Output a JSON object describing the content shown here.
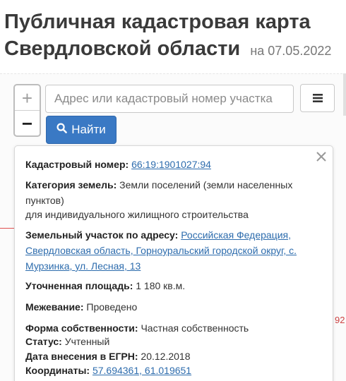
{
  "header": {
    "title": "Публичная кадастровая карта Свердловской области",
    "date": "на 07.05.2022"
  },
  "map": {
    "edge_label": "92",
    "zoom_in": "+",
    "zoom_out": "−"
  },
  "search": {
    "placeholder": "Адрес или кадастровый номер участка",
    "button_label": "Найти"
  },
  "icons": {
    "menu": "menu-icon",
    "search": "search-icon",
    "close": "close-icon"
  },
  "colors": {
    "button": "#3a79c4",
    "link": "#2d6cad"
  },
  "info": {
    "cadastral_label": "Кадастровый номер:",
    "cadastral_value": "66:19:1901027:94",
    "category_label": "Категория земель:",
    "category_value": "Земли поселений (земли населенных пунктов)",
    "use_value": "для индивидуального жилищного строительства",
    "address_label": "Земельный участок по адресу:",
    "address_value": "Российская Федерация, Свердловская область, Горноуральский городской округ, с. Мурзинка, ул. Лесная, 13",
    "area_label": "Уточненная площадь:",
    "area_value": "1 180 кв.м.",
    "survey_label": "Межевание:",
    "survey_value": "Проведено",
    "ownership_label": "Форма собственности:",
    "ownership_value": "Частная собственность",
    "status_label": "Статус:",
    "status_value": "Учтенный",
    "egrn_label": "Дата внесения в ЕГРН:",
    "egrn_value": "20.12.2018",
    "coords_label": "Координаты:",
    "coords_value": "57.694361, 61.019651"
  }
}
